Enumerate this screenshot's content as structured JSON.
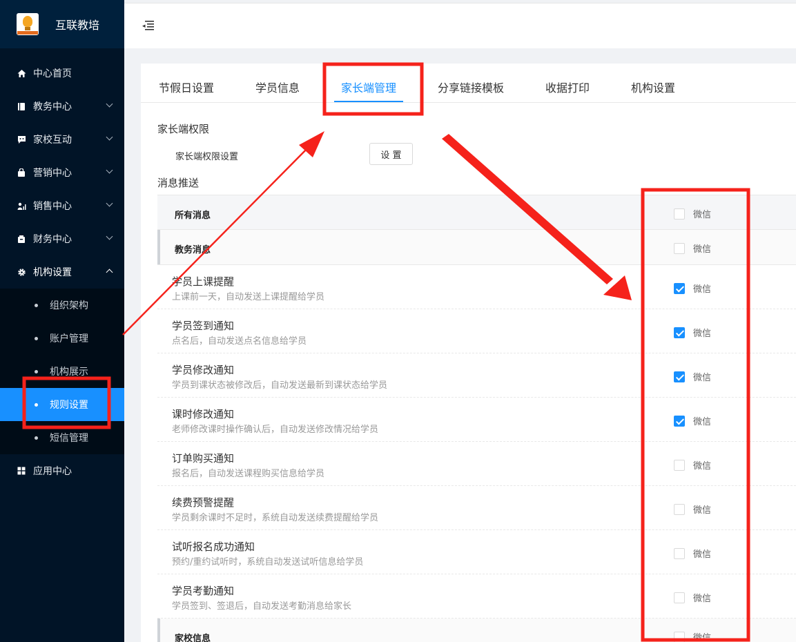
{
  "app": {
    "title": "互联教培",
    "logo_icon": "lightbulb-logo-icon"
  },
  "sidebar": {
    "items": [
      {
        "label": "中心首页",
        "icon": "home-icon"
      },
      {
        "label": "教务中心",
        "icon": "book-icon"
      },
      {
        "label": "家校互动",
        "icon": "chat-icon"
      },
      {
        "label": "营销中心",
        "icon": "bag-icon"
      },
      {
        "label": "销售中心",
        "icon": "people-chart-icon"
      },
      {
        "label": "财务中心",
        "icon": "wallet-icon"
      },
      {
        "label": "机构设置",
        "icon": "gear-icon"
      },
      {
        "label": "应用中心",
        "icon": "grid-icon"
      }
    ],
    "sub_items": [
      "组织架构",
      "账户管理",
      "机构展示",
      "规则设置",
      "短信管理"
    ],
    "active_sub": "规则设置"
  },
  "tabs": [
    "节假日设置",
    "学员信息",
    "家长端管理",
    "分享链接模板",
    "收据打印",
    "机构设置"
  ],
  "active_tab": "家长端管理",
  "permissions": {
    "section_title": "家长端权限",
    "row_label": "家长端权限设置",
    "button_label": "设 置"
  },
  "push": {
    "section_title": "消息推送",
    "channel_label": "微信",
    "header_label": "所有消息",
    "group1": "教务消息",
    "group2": "家校信息",
    "rows": [
      {
        "title": "学员上课提醒",
        "desc": "上课前一天，自动发送上课提醒给学员",
        "checked": true
      },
      {
        "title": "学员签到通知",
        "desc": "点名后，自动发送点名信息给学员",
        "checked": true
      },
      {
        "title": "学员修改通知",
        "desc": "学员到课状态被修改后，自动发送最新到课状态给学员",
        "checked": true
      },
      {
        "title": "课时修改通知",
        "desc": "老师修改课时操作确认后，自动发送修改情况给学员",
        "checked": true
      },
      {
        "title": "订单购买通知",
        "desc": "报名后，自动发送课程购买信息给学员",
        "checked": false
      },
      {
        "title": "续费预警提醒",
        "desc": "学员剩余课时不足时，系统自动发送续费提醒给学员",
        "checked": false
      },
      {
        "title": "试听报名成功通知",
        "desc": "预约/重约试听时，系统自动发送试听信息给学员",
        "checked": false
      },
      {
        "title": "学员考勤通知",
        "desc": "学员签到、签退后，自动发送考勤消息给家长",
        "checked": false
      }
    ]
  },
  "colors": {
    "accent": "#1890ff",
    "sidebar_bg": "#011427",
    "annotation": "#f5221b"
  }
}
